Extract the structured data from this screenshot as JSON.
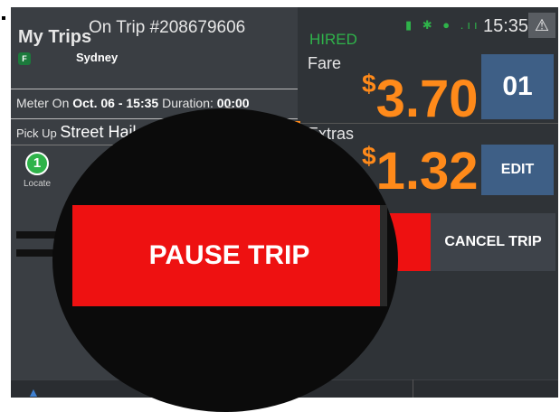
{
  "header": {
    "title": "My Trips",
    "trip_label": "On Trip #208679606",
    "time": "15:35",
    "status_icons": "▮ ✱ ● .ıı",
    "warning_icon": "warning-icon"
  },
  "trip": {
    "flag": "F",
    "city": "Sydney",
    "meter_on_label": "Meter On",
    "meter_on_value": "Oct. 06 - 15:35",
    "duration_label": "Duration:",
    "duration_value": "00:00",
    "pickup_label": "Pick Up",
    "pickup_value": "Street Hail",
    "locate_number": "1",
    "locate_label": "Locate"
  },
  "fare": {
    "status": "HIRED",
    "fare_label": "Fare",
    "fare_currency": "$",
    "fare_amount": "3.70",
    "count_button": "01",
    "extras_label": "Extras",
    "extras_currency": "$",
    "extras_amount": "1.32",
    "edit_button": "EDIT"
  },
  "actions": {
    "pause_button": "PAUSE TRIP",
    "cancel_button": "CANCEL TRIP"
  },
  "colors": {
    "accent_orange": "#ff8a1a",
    "hired_green": "#2fb34a",
    "pause_red": "#ee1111",
    "button_blue": "#3e5f86",
    "background": "#2f3337"
  }
}
